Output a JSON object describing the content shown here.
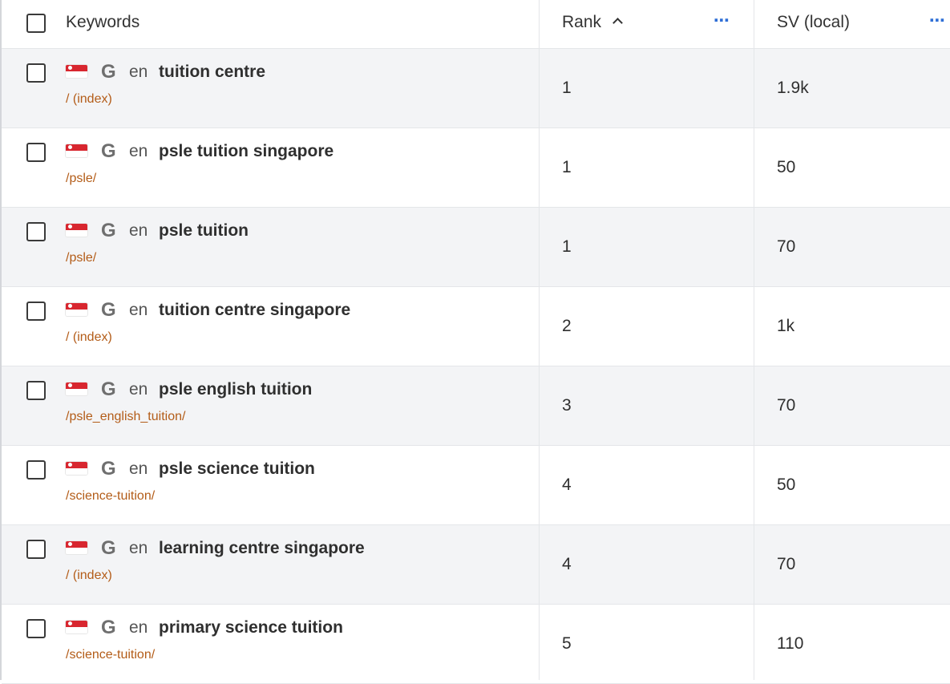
{
  "header": {
    "keywords_label": "Keywords",
    "rank_label": "Rank",
    "sv_label": "SV (local)",
    "more_glyph": "⋯",
    "rank_sort": "ascending"
  },
  "rows": [
    {
      "lang": "en",
      "keyword": "tuition centre",
      "url": "/ (index)",
      "rank": "1",
      "sv": "1.9k",
      "country": "Singapore",
      "engine": "Google"
    },
    {
      "lang": "en",
      "keyword": "psle tuition singapore",
      "url": "/psle/",
      "rank": "1",
      "sv": "50",
      "country": "Singapore",
      "engine": "Google"
    },
    {
      "lang": "en",
      "keyword": "psle tuition",
      "url": "/psle/",
      "rank": "1",
      "sv": "70",
      "country": "Singapore",
      "engine": "Google"
    },
    {
      "lang": "en",
      "keyword": "tuition centre singapore",
      "url": "/ (index)",
      "rank": "2",
      "sv": "1k",
      "country": "Singapore",
      "engine": "Google"
    },
    {
      "lang": "en",
      "keyword": "psle english tuition",
      "url": "/psle_english_tuition/",
      "rank": "3",
      "sv": "70",
      "country": "Singapore",
      "engine": "Google"
    },
    {
      "lang": "en",
      "keyword": "psle science tuition",
      "url": "/science-tuition/",
      "rank": "4",
      "sv": "50",
      "country": "Singapore",
      "engine": "Google"
    },
    {
      "lang": "en",
      "keyword": "learning centre singapore",
      "url": "/ (index)",
      "rank": "4",
      "sv": "70",
      "country": "Singapore",
      "engine": "Google"
    },
    {
      "lang": "en",
      "keyword": "primary science tuition",
      "url": "/science-tuition/",
      "rank": "5",
      "sv": "110",
      "country": "Singapore",
      "engine": "Google"
    }
  ],
  "icons": {
    "engine_glyph": "G",
    "flag": "singapore-flag-icon",
    "engine": "google-icon"
  },
  "colors": {
    "url": "#b35c18",
    "more_dots": "#2f6fd6",
    "row_alt_bg": "#f3f4f6"
  }
}
